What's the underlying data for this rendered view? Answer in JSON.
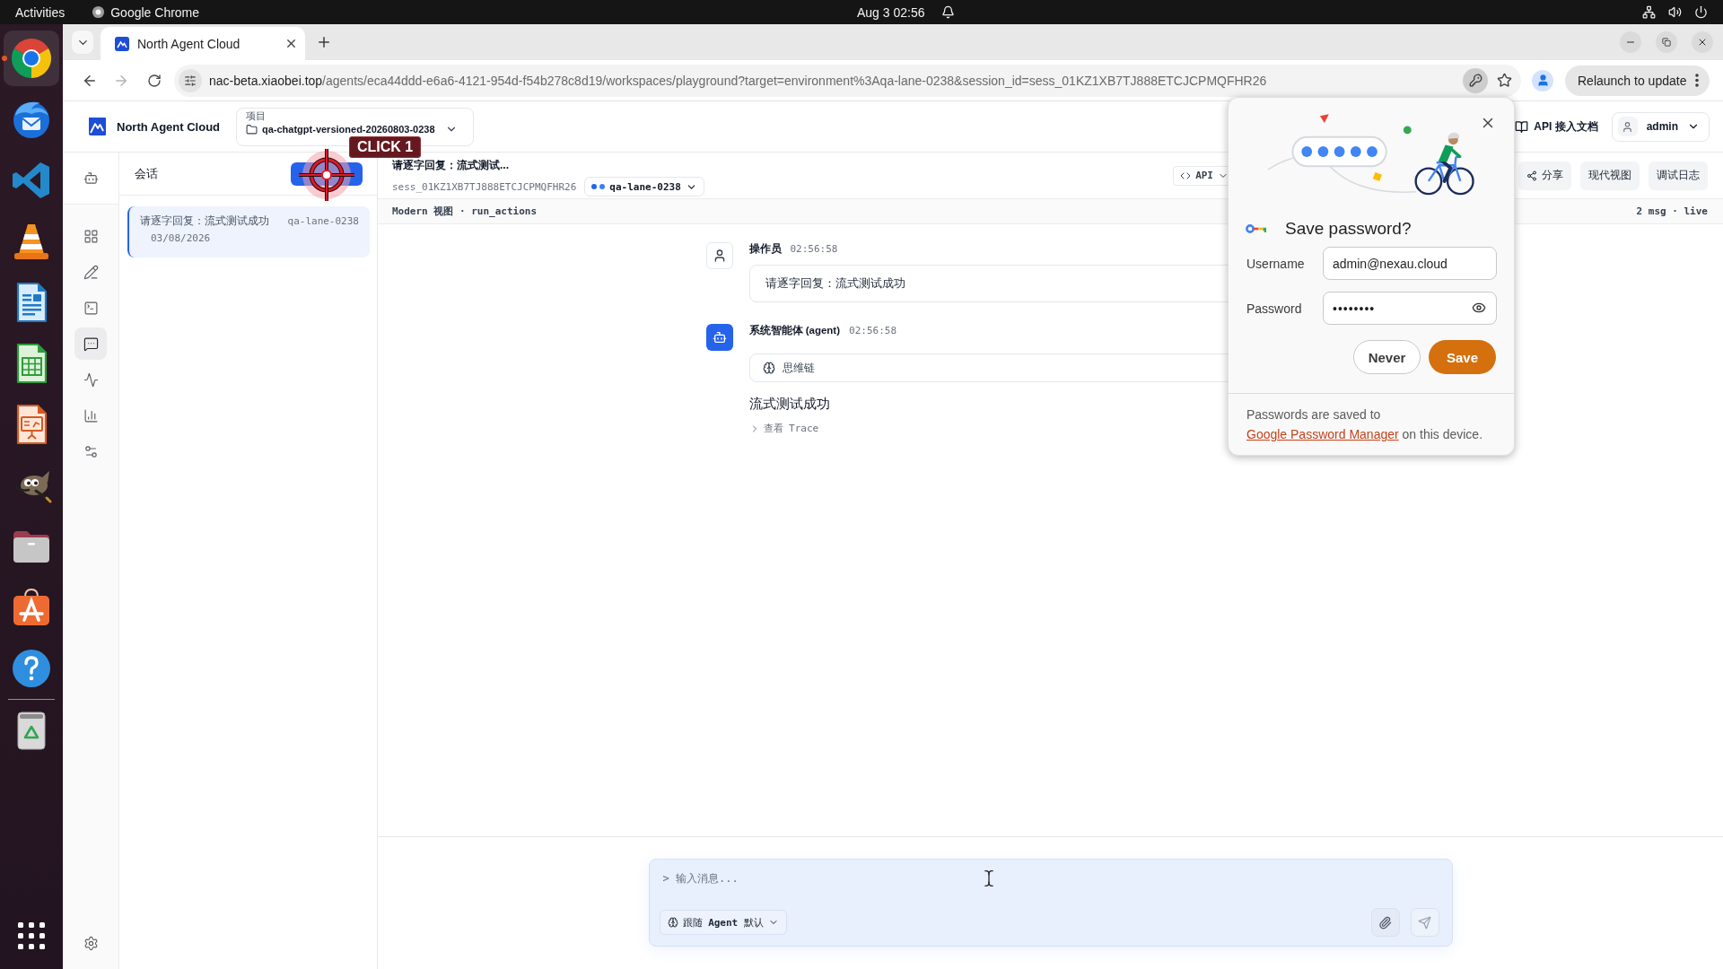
{
  "desktop_bar": {
    "activities": "Activities",
    "app_menu": "Google Chrome",
    "clock": "Aug 3  02:56"
  },
  "dock": {
    "items": [
      {
        "kind": "browser",
        "running": true,
        "focused": true
      },
      {
        "kind": "mail",
        "running": false,
        "focused": false
      },
      {
        "kind": "code",
        "running": false,
        "focused": false
      },
      {
        "kind": "media",
        "running": false,
        "focused": false
      },
      {
        "kind": "writer",
        "running": false,
        "focused": false
      },
      {
        "kind": "calc",
        "running": false,
        "focused": false
      },
      {
        "kind": "impress",
        "running": false,
        "focused": false
      },
      {
        "kind": "graphics",
        "running": false,
        "focused": false
      },
      {
        "kind": "files",
        "running": false,
        "focused": false
      },
      {
        "kind": "store",
        "running": false,
        "focused": false
      },
      {
        "kind": "help",
        "running": false,
        "focused": false
      },
      {
        "kind": "trash",
        "running": false,
        "focused": false
      }
    ]
  },
  "browser": {
    "tabs": [
      {
        "title": "North Agent Cloud",
        "selected": true
      }
    ],
    "forward_disabled": true,
    "address": {
      "host": "nac-beta.xiaobei.top",
      "path": "/agents/eca44ddd-e6a6-4121-954d-f54b278c8d19/workspaces/playground?target=environment%3Aqa-lane-0238&session_id=sess_01KZ1XB7TJ888ETCJCPMQFHR26"
    },
    "relaunch_button": "Relaunch to update"
  },
  "app_header": {
    "brand": "North Agent Cloud",
    "project": {
      "label": "项目",
      "name": "qa-chatgpt-versioned-20260803-0238"
    },
    "docs_link": "API 接入文档",
    "user": "admin"
  },
  "nav_rail": {
    "items": [
      {
        "kind": "agent",
        "selected": false
      },
      {
        "kind": "dashboard",
        "selected": false
      },
      {
        "kind": "editor",
        "selected": false
      },
      {
        "kind": "terminal",
        "selected": false
      },
      {
        "kind": "chat",
        "selected": true
      },
      {
        "kind": "activity",
        "selected": false
      },
      {
        "kind": "analytics",
        "selected": false
      },
      {
        "kind": "controls",
        "selected": false
      },
      {
        "kind": "settings",
        "selected": false
      }
    ]
  },
  "sessions": {
    "title": "会话",
    "items": [
      {
        "title": "请逐字回复：流式测试成功",
        "lane": "qa-lane-0238",
        "date": "03/08/2026",
        "selected": true
      }
    ]
  },
  "session": {
    "title": "请逐字回复：流式测试...",
    "id": "sess_01KZ1XB7TJ888ETCJCPMQFHR26",
    "lane": "qa-lane-0238",
    "api_button": "API",
    "actions": [
      {
        "kind": "share",
        "label": "分享"
      },
      {
        "kind": "plain",
        "label": "现代视图"
      },
      {
        "kind": "plain",
        "label": "调试日志"
      }
    ]
  },
  "view_bar": {
    "mode": "Modern 视图 · run_actions",
    "stats": "2 msg · live"
  },
  "messages": [
    {
      "kind": "user",
      "author": "操作员",
      "time": "02:56:58",
      "text": "请逐字回复：流式测试成功"
    },
    {
      "kind": "agent",
      "author": "系统智能体 (agent)",
      "time": "02:56:58",
      "reasoning": "思维链",
      "text": "流式测试成功",
      "trace": "查看 Trace"
    }
  ],
  "composer": {
    "placeholder": "> 输入消息...",
    "mode": "跟随 **Agent** 默认",
    "send_disabled": true
  },
  "password_dialog": {
    "title": "Save password?",
    "username_label": "Username",
    "username": "admin@nexau.cloud",
    "password_label": "Password",
    "password": "••••••••",
    "buttons": [
      {
        "kind": "secondary",
        "label": "Never"
      },
      {
        "kind": "primary",
        "label": "Save"
      }
    ],
    "note": "Passwords are saved to",
    "note_link": "Google Password Manager",
    "note_end": "on this device."
  },
  "click_marker": {
    "label": "CLICK 1"
  }
}
